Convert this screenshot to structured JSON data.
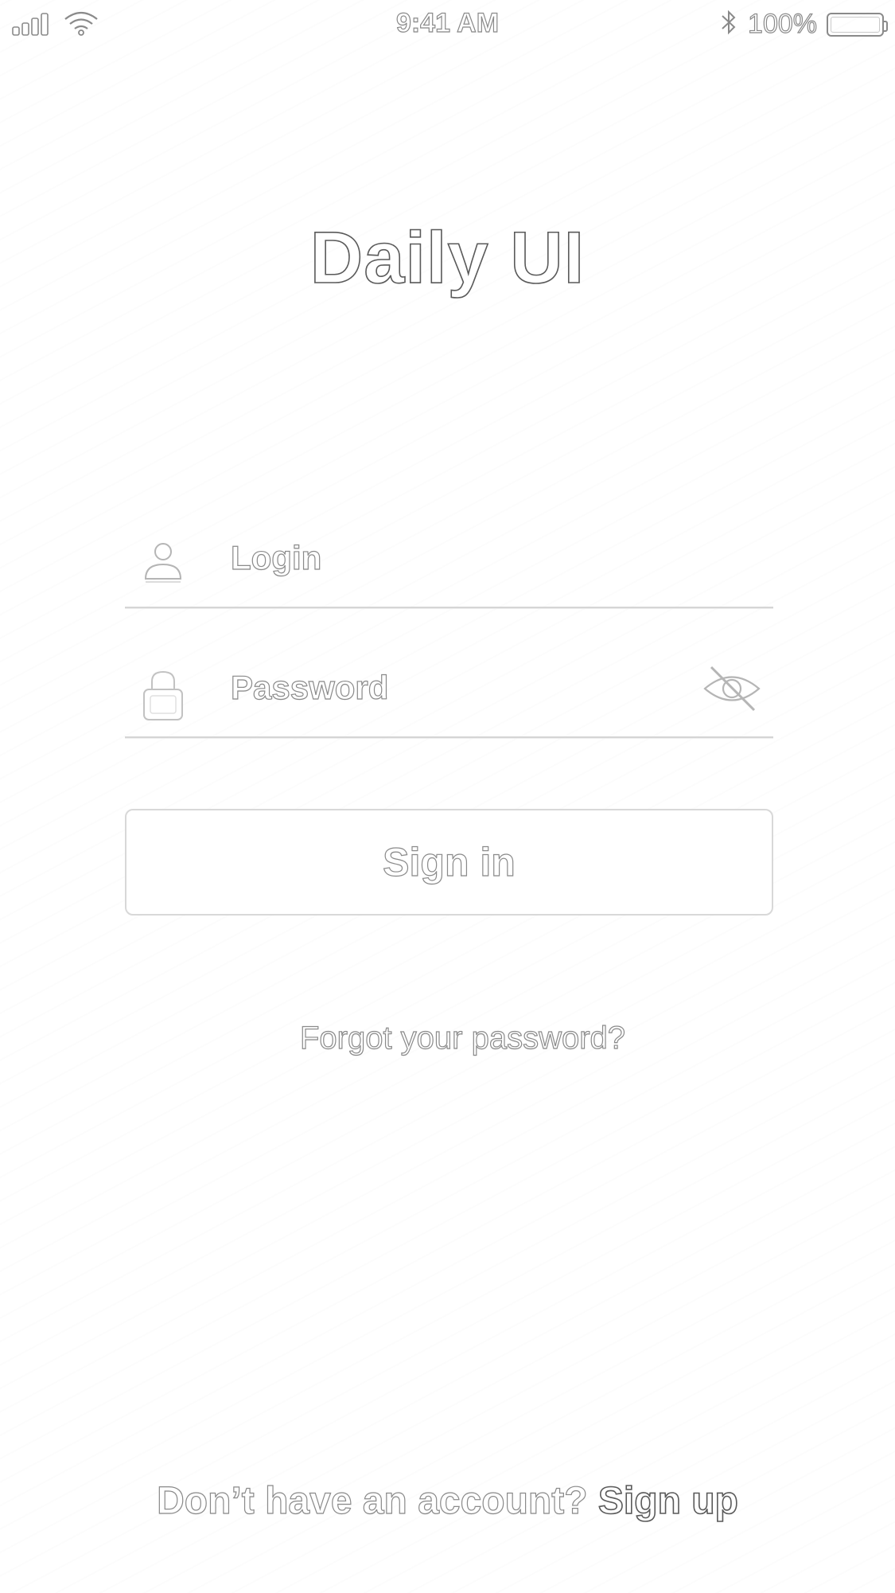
{
  "status_bar": {
    "time": "9:41 AM",
    "battery_percent": "100%",
    "icons": {
      "signal": "signal-icon",
      "wifi": "wifi-icon",
      "bluetooth": "bluetooth-icon",
      "battery": "battery-icon"
    }
  },
  "header": {
    "title": "Daily UI"
  },
  "form": {
    "login": {
      "placeholder": "Login",
      "icon": "user-icon"
    },
    "password": {
      "placeholder": "Password",
      "icon": "lock-icon",
      "toggle_icon": "eye-off-icon"
    },
    "sign_in_label": "Sign in",
    "forgot_label": "Forgot your password?"
  },
  "footer": {
    "prompt": "Don’t have an account?",
    "signup_label": "Sign up"
  },
  "colors": {
    "background": "#ffffff",
    "outline": "#8a8a8a",
    "divider": "#d5d5d5"
  }
}
